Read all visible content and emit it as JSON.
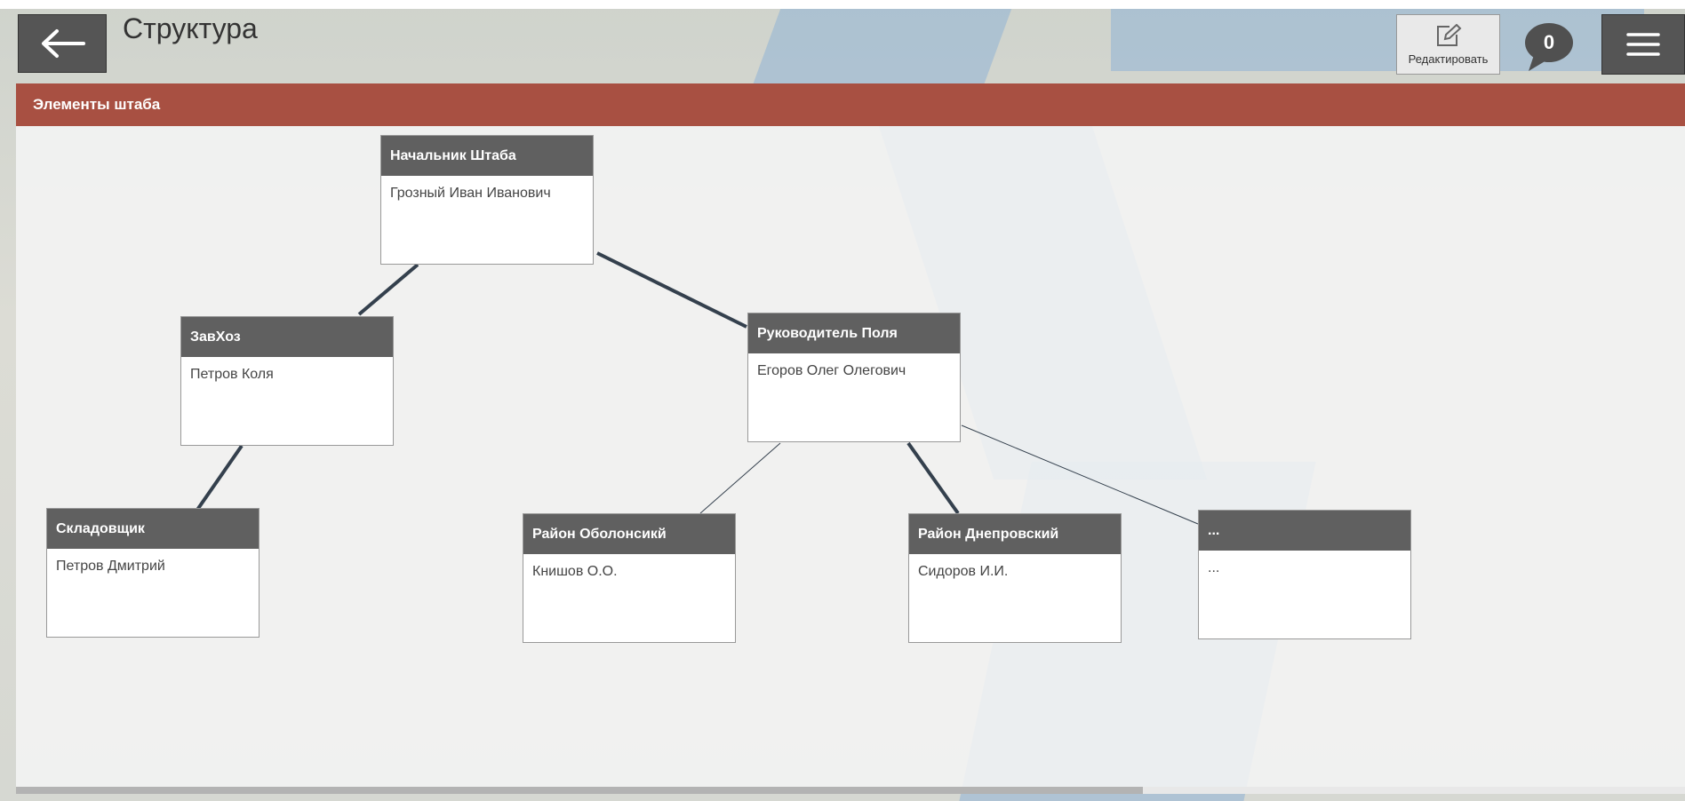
{
  "header": {
    "title": "Структура",
    "edit_label": "Редактировать",
    "chat_count": "0"
  },
  "panel": {
    "title": "Элементы штаба"
  },
  "nodes": [
    {
      "role": "Начальник Штаба",
      "person": "Грозный Иван Иванович"
    },
    {
      "role": "ЗавХоз",
      "person": "Петров Коля"
    },
    {
      "role": "Руководитель Поля",
      "person": "Егоров Олег Олегович"
    },
    {
      "role": "Складовщик",
      "person": "Петров Дмитрий"
    },
    {
      "role": "Район Оболонсикй",
      "person": "Книшов О.О."
    },
    {
      "role": "Район Днепровский",
      "person": "Сидоров И.И."
    },
    {
      "role": "...",
      "person": "..."
    }
  ],
  "colors": {
    "accent": "#a85042",
    "node_header": "#606060",
    "connector": "#34404d"
  },
  "icons": {
    "back": "arrow-left-icon",
    "edit": "edit-icon",
    "chat": "speech-bubble-icon",
    "menu": "hamburger-menu-icon"
  }
}
